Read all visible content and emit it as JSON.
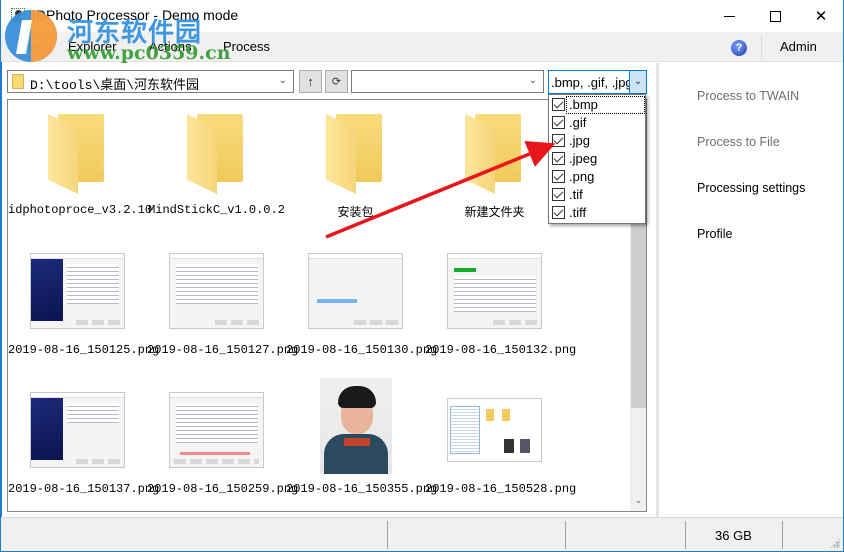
{
  "window": {
    "title": "IDPhoto Processor - Demo mode",
    "controls": {
      "minimize": "minimize",
      "maximize": "maximize",
      "close": "close"
    }
  },
  "watermark": {
    "text_cn": "河东软件园",
    "url": "www.pc0359.cn"
  },
  "menubar": {
    "items": [
      {
        "label": "File"
      },
      {
        "label": "Explorer"
      },
      {
        "label": "Actions"
      },
      {
        "label": "Process"
      }
    ],
    "help_icon": "?",
    "user": "Admin"
  },
  "toolbar": {
    "path": "D:\\tools\\桌面\\河东软件园",
    "up_icon": "↑",
    "refresh_icon": "⟳",
    "filter_value": "",
    "extension_value": ".bmp, .gif, .jpg",
    "dropdown_arrow": "⌄"
  },
  "extensions_dropdown": {
    "items": [
      {
        "label": ".bmp",
        "checked": true,
        "focused": true
      },
      {
        "label": ".gif",
        "checked": true
      },
      {
        "label": ".jpg",
        "checked": true
      },
      {
        "label": ".jpeg",
        "checked": true
      },
      {
        "label": ".png",
        "checked": true
      },
      {
        "label": ".tif",
        "checked": true
      },
      {
        "label": ".tiff",
        "checked": true
      }
    ]
  },
  "files": [
    {
      "name": "idphotoproce_v3.2.10",
      "type": "folder"
    },
    {
      "name": "MindStickC_v1.0.0.2",
      "type": "folder"
    },
    {
      "name": "安装包",
      "type": "folder"
    },
    {
      "name": "新建文件夹",
      "type": "folder"
    },
    {
      "name": "2019-08-16_150125.png",
      "type": "image",
      "thumb": "setup-welcome"
    },
    {
      "name": "2019-08-16_150127.png",
      "type": "image",
      "thumb": "license"
    },
    {
      "name": "2019-08-16_150130.png",
      "type": "image",
      "thumb": "install-location"
    },
    {
      "name": "2019-08-16_150132.png",
      "type": "image",
      "thumb": "installing"
    },
    {
      "name": "2019-08-16_150137.png",
      "type": "image",
      "thumb": "setup-complete"
    },
    {
      "name": "2019-08-16_150259.png",
      "type": "image",
      "thumb": "activation"
    },
    {
      "name": "2019-08-16_150355.png",
      "type": "image",
      "thumb": "portrait"
    },
    {
      "name": "2019-08-16_150528.png",
      "type": "image",
      "thumb": "app-screenshot"
    }
  ],
  "scrollbar": {
    "position_fraction": 0.0,
    "visible_fraction": 0.78
  },
  "right_panel": {
    "items": [
      {
        "label": "Process to TWAIN",
        "enabled": false
      },
      {
        "label": "Process to File",
        "enabled": false
      },
      {
        "label": "Processing settings",
        "enabled": true
      },
      {
        "label": "Profile",
        "enabled": true
      }
    ]
  },
  "statusbar": {
    "disk_free": "36 GB"
  },
  "colors": {
    "accent": "#0078d7",
    "annotation_arrow": "#e8161b",
    "folder": "#f6d57a"
  }
}
